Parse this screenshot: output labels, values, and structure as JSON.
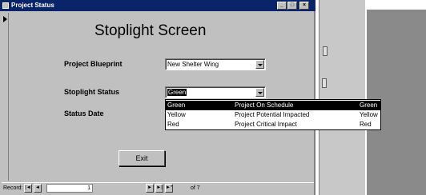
{
  "window": {
    "title": "Project Status"
  },
  "form": {
    "heading": "Stoplight Screen",
    "project_label": "Project Blueprint",
    "project_value": "New Shelter Wing",
    "status_label": "Stoplight Status",
    "status_value": "Green",
    "date_label": "Status Date"
  },
  "dropdown": {
    "rows": [
      {
        "col1": "Green",
        "col2": "Project On Schedule",
        "col3": "Green"
      },
      {
        "col1": "Yellow",
        "col2": "Project Potential Impacted",
        "col3": "Yellow"
      },
      {
        "col1": "Red",
        "col2": "Project Critical Impact",
        "col3": "Red"
      }
    ]
  },
  "buttons": {
    "exit": "Exit"
  },
  "navigator": {
    "label": "Record:",
    "current": "1",
    "of_text": "of 7"
  },
  "colors": {
    "titlebar": "#0a246a",
    "face": "#c0c0c0",
    "selection": "#000000"
  }
}
